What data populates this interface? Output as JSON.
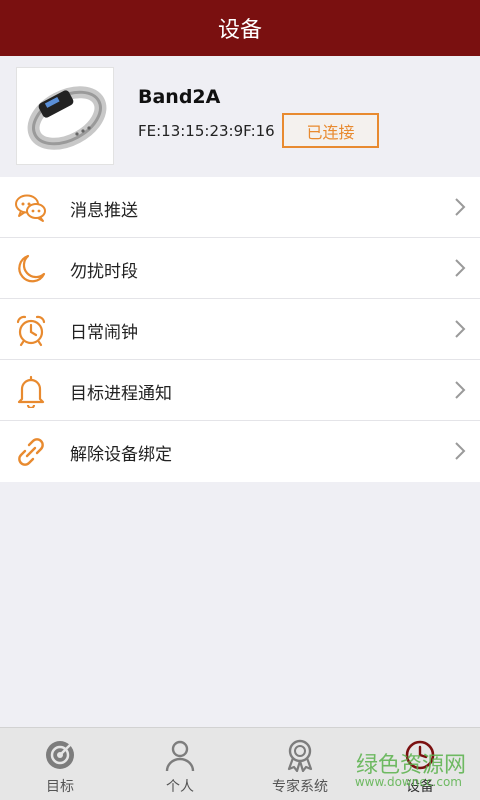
{
  "header": {
    "title": "设备"
  },
  "device": {
    "name": "Band2A",
    "mac": "FE:13:15:23:9F:16",
    "status": "已连接"
  },
  "menu": {
    "items": [
      {
        "label": "消息推送",
        "icon": "message-push-icon"
      },
      {
        "label": "勿扰时段",
        "icon": "moon-icon"
      },
      {
        "label": "日常闹钟",
        "icon": "alarm-clock-icon"
      },
      {
        "label": "目标进程通知",
        "icon": "bell-icon"
      },
      {
        "label": "解除设备绑定",
        "icon": "link-icon"
      }
    ]
  },
  "tabbar": {
    "tabs": [
      {
        "label": "目标",
        "icon": "target-icon"
      },
      {
        "label": "个人",
        "icon": "person-icon"
      },
      {
        "label": "专家系统",
        "icon": "award-icon"
      },
      {
        "label": "设备",
        "icon": "clock-icon"
      }
    ]
  },
  "watermark": {
    "text": "绿色资源网",
    "sub": "www.downcc.com"
  },
  "colors": {
    "header_bg": "#7a1010",
    "accent": "#e88a2f",
    "page_bg": "#efeff4",
    "watermark": "#5ab24c"
  }
}
